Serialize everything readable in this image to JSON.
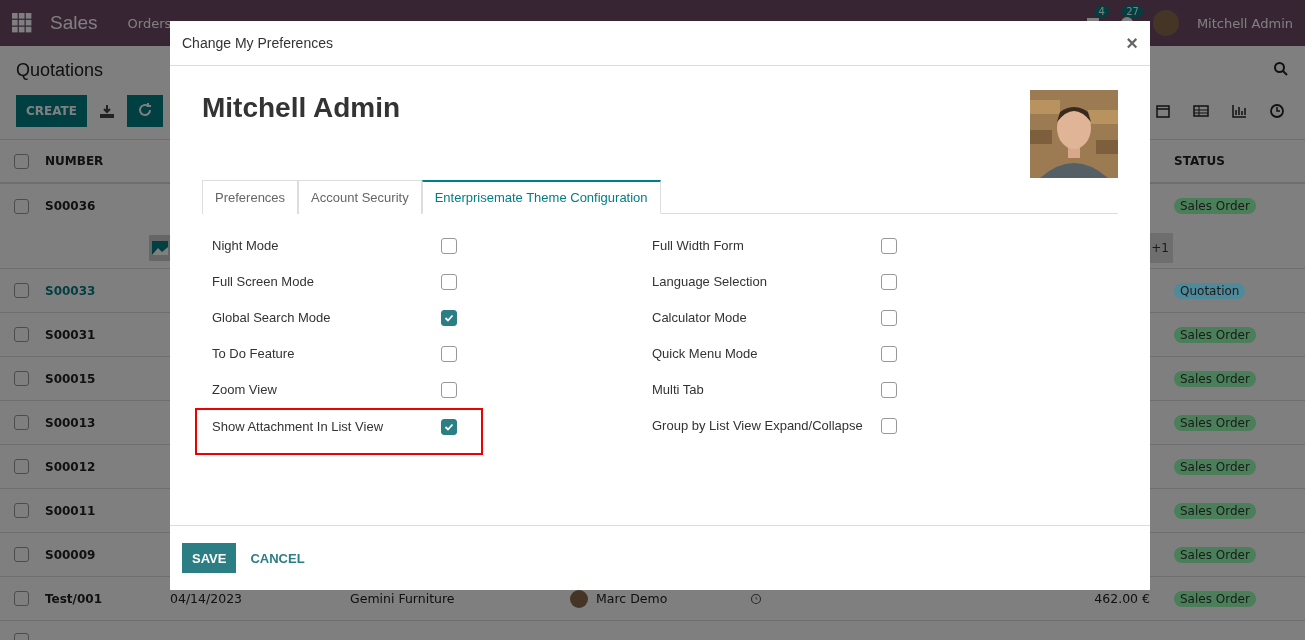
{
  "navbar": {
    "app": "Sales",
    "menu": [
      "Orders"
    ],
    "chat_count": "4",
    "activity_count": "27",
    "user": "Mitchell Admin"
  },
  "control_panel": {
    "title": "Quotations",
    "create": "CREATE"
  },
  "table": {
    "select_all_checked": false,
    "columns": [
      "NUMBER",
      "STATUS"
    ],
    "rows": [
      {
        "selected": false,
        "number": "S00036",
        "link": false,
        "status": "Sales Order",
        "color": "#4a7f5a",
        "attachments_more": "+1"
      },
      {
        "selected": false,
        "number": "S00033",
        "link": true,
        "status": "Quotation",
        "color": "#4f8a9a"
      },
      {
        "selected": false,
        "number": "S00031",
        "link": false,
        "status": "Sales Order",
        "color": "#4a7f5a"
      },
      {
        "selected": false,
        "number": "S00015",
        "link": false,
        "status": "Sales Order",
        "color": "#4a7f5a"
      },
      {
        "selected": false,
        "number": "S00013",
        "link": false,
        "status": "Sales Order",
        "color": "#4a7f5a"
      },
      {
        "selected": false,
        "number": "S00012",
        "link": false,
        "status": "Sales Order",
        "color": "#4a7f5a"
      },
      {
        "selected": false,
        "number": "S00011",
        "link": false,
        "status": "Sales Order",
        "color": "#4a7f5a"
      },
      {
        "selected": false,
        "number": "S00009",
        "link": false,
        "status": "Sales Order",
        "color": "#4a7f5a"
      },
      {
        "selected": false,
        "number": "Test/001",
        "link": false,
        "date": "04/14/2023",
        "customer": "Gemini Furniture",
        "salesperson": "Marc Demo",
        "total": "462.00 €",
        "status": "Sales Order",
        "color": "#4a7f5a"
      },
      {
        "selected": false
      }
    ]
  },
  "dialog": {
    "title": "Change My Preferences",
    "close": "×",
    "name": "Mitchell Admin",
    "tabs": [
      {
        "label": "Preferences",
        "selected": false
      },
      {
        "label": "Account Security",
        "selected": false
      },
      {
        "label": "Enterprisemate Theme Configuration",
        "selected": true
      }
    ],
    "left_options": [
      {
        "label": "Night Mode",
        "checked": false,
        "highlighted": false
      },
      {
        "label": "Full Screen Mode",
        "checked": false,
        "highlighted": false
      },
      {
        "label": "Global Search Mode",
        "checked": true,
        "highlighted": false
      },
      {
        "label": "To Do Feature",
        "checked": false,
        "highlighted": false
      },
      {
        "label": "Zoom View",
        "checked": false,
        "highlighted": false
      },
      {
        "label": "Show Attachment In List View",
        "checked": true,
        "highlighted": true
      }
    ],
    "right_options": [
      {
        "label": "Full Width Form",
        "checked": false,
        "highlighted": false
      },
      {
        "label": "Language Selection",
        "checked": false,
        "highlighted": false
      },
      {
        "label": "Calculator Mode",
        "checked": false,
        "highlighted": false
      },
      {
        "label": "Quick Menu Mode",
        "checked": false,
        "highlighted": false
      },
      {
        "label": "Multi Tab",
        "checked": false,
        "highlighted": false
      },
      {
        "label": "Group by List View Expand/Collapse",
        "checked": false,
        "highlighted": false
      }
    ],
    "buttons": [
      {
        "label": "SAVE",
        "kind": "primary"
      },
      {
        "label": "CANCEL",
        "kind": "link"
      }
    ]
  }
}
